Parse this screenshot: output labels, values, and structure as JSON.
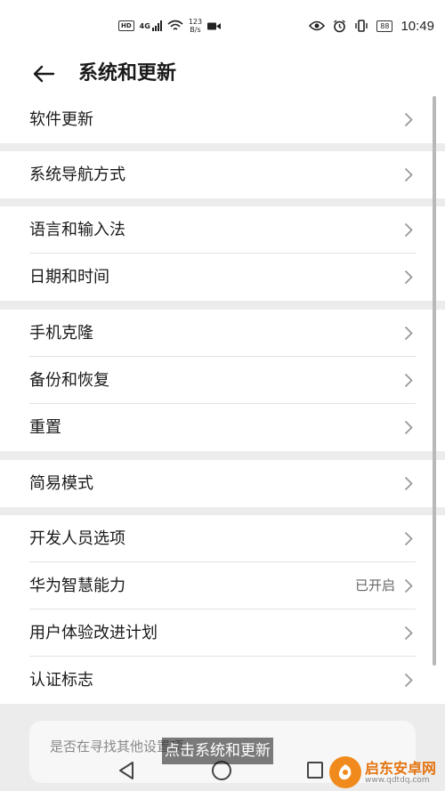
{
  "status_bar": {
    "hd_badge": "HD",
    "network": "4G",
    "speed_value": "123",
    "speed_unit": "B/s",
    "battery": "88",
    "time": "10:49"
  },
  "header": {
    "title": "系统和更新"
  },
  "groups": [
    {
      "items": [
        {
          "label": "软件更新",
          "value": ""
        }
      ]
    },
    {
      "items": [
        {
          "label": "系统导航方式",
          "value": ""
        }
      ]
    },
    {
      "items": [
        {
          "label": "语言和输入法",
          "value": ""
        },
        {
          "label": "日期和时间",
          "value": ""
        }
      ]
    },
    {
      "items": [
        {
          "label": "手机克隆",
          "value": ""
        },
        {
          "label": "备份和恢复",
          "value": ""
        },
        {
          "label": "重置",
          "value": ""
        }
      ]
    },
    {
      "items": [
        {
          "label": "简易模式",
          "value": ""
        }
      ]
    },
    {
      "items": [
        {
          "label": "开发人员选项",
          "value": ""
        },
        {
          "label": "华为智慧能力",
          "value": "已开启"
        },
        {
          "label": "用户体验改进计划",
          "value": ""
        },
        {
          "label": "认证标志",
          "value": ""
        }
      ]
    }
  ],
  "suggestion": {
    "text": "是否在寻找其他设置项"
  },
  "subtitle": {
    "text": "点击系统和更新"
  },
  "watermark": {
    "name": "启东安卓网",
    "url": "www.qdtdq.com"
  },
  "colors": {
    "background": "#ececec",
    "card": "#ffffff",
    "chevron": "#999999",
    "watermark_brand": "#f08a1c"
  },
  "icons": {
    "back": "arrow-left-icon",
    "chevron": "chevron-right-icon",
    "nav_back": "triangle-back-icon",
    "nav_home": "circle-home-icon",
    "nav_recent": "square-recent-icon"
  }
}
